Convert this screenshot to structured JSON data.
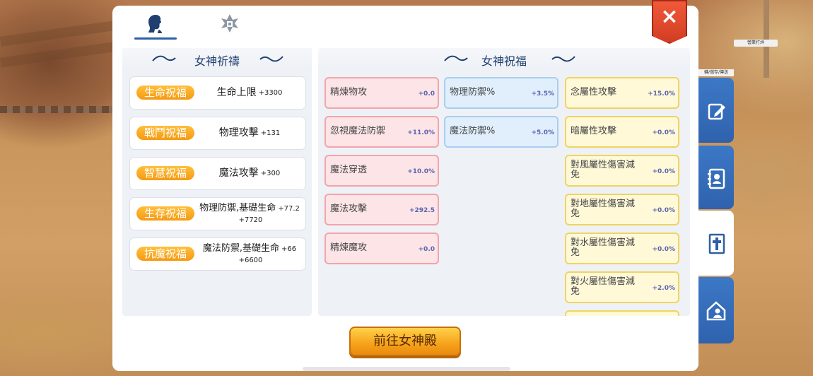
{
  "background": {
    "signs": [
      "營業打烊",
      "轉/儲存/傳送"
    ]
  },
  "tabs": [
    {
      "name": "goddess-tab",
      "icon": "goddess-head-icon",
      "active": true
    },
    {
      "name": "emblem-tab",
      "icon": "emblem-icon",
      "active": false
    }
  ],
  "close": {
    "label": "×",
    "color": "#e04a2c"
  },
  "left_panel": {
    "title": "女神祈禱",
    "blessings": [
      {
        "tag": "生命祝福",
        "stat": "生命上限",
        "value": "+3300"
      },
      {
        "tag": "戰鬥祝福",
        "stat": "物理攻擊",
        "value": "+131"
      },
      {
        "tag": "智慧祝福",
        "stat": "魔法攻擊",
        "value": "+300"
      },
      {
        "tag": "生存祝福",
        "stat": "物理防禦,基礎生命",
        "value": "+77.2",
        "value2": "+7720"
      },
      {
        "tag": "抗魔祝福",
        "stat": "魔法防禦,基礎生命",
        "value": "+66",
        "value2": "+6600"
      }
    ]
  },
  "right_panel": {
    "title": "女神祝福",
    "columns": [
      {
        "color": "red",
        "items": [
          {
            "name": "精煉物攻",
            "value": "+0.0"
          },
          {
            "name": "忽視魔法防禦",
            "value": "+11.0%"
          },
          {
            "name": "魔法穿透",
            "value": "+10.0%"
          },
          {
            "name": "魔法攻擊",
            "value": "+292.5"
          },
          {
            "name": "精煉魔攻",
            "value": "+0.0"
          }
        ]
      },
      {
        "color": "blue",
        "items": [
          {
            "name": "物理防禦%",
            "value": "+3.5%"
          },
          {
            "name": "魔法防禦%",
            "value": "+5.0%"
          }
        ]
      },
      {
        "color": "yellow",
        "items": [
          {
            "name": "念屬性攻擊",
            "value": "+15.0%"
          },
          {
            "name": "暗屬性攻擊",
            "value": "+0.0%"
          },
          {
            "name": "對風屬性傷害減免",
            "value": "+0.0%"
          },
          {
            "name": "對地屬性傷害減免",
            "value": "+0.0%"
          },
          {
            "name": "對水屬性傷害減免",
            "value": "+0.0%"
          },
          {
            "name": "對火屬性傷害減免",
            "value": "+2.0%"
          }
        ]
      }
    ]
  },
  "go_button": {
    "label": "前往女神殿"
  },
  "side_tabs": [
    {
      "name": "edit-icon",
      "active": false
    },
    {
      "name": "contact-book-icon",
      "active": false
    },
    {
      "name": "cross-icon",
      "active": true
    },
    {
      "name": "guild-house-icon",
      "active": false
    }
  ]
}
